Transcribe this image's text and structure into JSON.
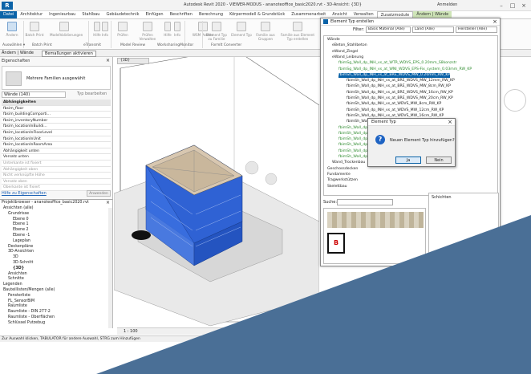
{
  "app": {
    "title": "Autodesk Revit 2020 - VIEWER-MODUS - ananoteoffice_basic2020.rvt - 3D-Ansicht: {3D}",
    "logo": "R",
    "user": "Anmelden"
  },
  "tabs": [
    "Datei",
    "Architektur",
    "Ingenieurbau",
    "Stahlbau",
    "Gebäudetechnik",
    "Einfügen",
    "Beschriften",
    "Berechnung",
    "Körpermodell & Grundstück",
    "Zusammenarbeit",
    "Ansicht",
    "Verwalten",
    "Zusatzmodule",
    "Ändern | Wände"
  ],
  "ribbon": {
    "buttons": [
      "Ändern",
      "Batch Print",
      "ModelValidierungen",
      "Hilfe",
      "Info",
      "Prüfen",
      "Prüfen Verwalten",
      "Hilfe",
      "Info",
      "WSM Palette",
      "Element Typ zu Familie",
      "Element Typ",
      "Familie aus Gruppen",
      "Familie aus Element Typ erstellen"
    ],
    "groups": [
      "Auswählen ▾",
      "Batch Print",
      "eTransmit",
      "Model Review",
      "WorksharingMonitor",
      "FormIt Converter"
    ]
  },
  "options_bar": {
    "context": "Ändern | Wände",
    "button": "Bemaßungen aktivieren"
  },
  "properties": {
    "title": "Eigenschaften",
    "family_selector": "Mehrere Familien ausgewählt",
    "instance_filter": "Wände (140)",
    "edit_type": "Typ bearbeiten",
    "rows": [
      "Abhängigkeiten",
      "fbsim_floor",
      "fbsim_buildingComparti...",
      "fbsim_inventoryNumber",
      "fbsim_locationInBuildi...",
      "fbsim_locationInFloorLevel",
      "fbsim_locationInUnit",
      "fbsim_locationInRoomArea",
      "Abhängigkeit unten",
      "Versatz unten",
      "Unterkante ist fixiert",
      "Abhängigkeit oben",
      "Nicht verknüpfte Höhe",
      "Versatz oben",
      "Oberkante ist fixiert"
    ],
    "help_link": "Hilfe zu Eigenschaften",
    "apply": "Anwenden"
  },
  "project_browser": {
    "title": "Projektbrowser - ananoteoffice_basic2020.rvt",
    "items": [
      "Ansichten (alle)",
      "Grundrisse",
      "Ebene 0",
      "Ebene 1",
      "Ebene 2",
      "Ebene -1",
      "Lageplan",
      "Deckenpläne",
      "3D-Ansichten",
      "3D",
      "3D-Schnitt",
      "{3D}",
      "Ansichten",
      "Schnitte",
      "Legenden",
      "Bauteillisten/Mengen (alle)",
      "Fensterliste",
      "FL_SensorBIM",
      "Raumliste",
      "Raumliste - DIN 277-2",
      "Raumliste - Oberflächen",
      "Schlüssel Putzebug"
    ]
  },
  "viewport": {
    "tab": "{3D}",
    "scale": "1 : 100"
  },
  "status_bar": "Zur Auswahl klicken, TABULATOR für andere Auswahl, STRG zum Hinzufügen",
  "element_type_dialog": {
    "title": "Element Typ erstellen",
    "filter_label": "Filter:",
    "filters": [
      "Basis Material (Alle)",
      "Land (Alle)",
      "Hersteller (Alle)"
    ],
    "tree": [
      "Wände",
      "eBeton_Stahlbeton",
      "eWand_Ziegel",
      "eWand_Leibnung",
      "fbimSg_Wall_dp_INH_vs_at_WTR_WDVS_EPS_0.20mm_S8konzstr",
      "fbimSg_Wall_dp_INH_vs_at_WNI_WDVS_EPS-Fix_system_0.03mm_RW_KP",
      "fbimSh_Wall_dp_INH_vs_at_BRE_WDVS_MW_0.20mm_RW_KP",
      "fbimSh_Wall_dp_INH_vs_at_BRE_WDVS_MW_12mm_RW_KP",
      "fbimSh_Wall_dp_INH_vs_at_BRE_WDVS_MW_8cm_RW_KP",
      "fbimSh_Wall_dp_INH_vs_at_BRE_WDVS_MW_16cm_RW_KP",
      "fbimSh_Wall_dp_INH_vs_at_BRE_WDVS_MW_20cm_RW_KP",
      "fbimSh_Wall_dp_INH_vs_at_WDVS_MW_8cm_RW_KP",
      "fbimSh_Wall_dp_INH_vs_at_WDVS_MW_12cm_RW_KP",
      "fbimSh_Wall_dp_INH_vs_at_WDVS_MW_16cm_RW_KP",
      "fbimSh_Wall_dp_INH_vs_at_WDVS_MW_20cm_RW_KP",
      "fbimSh_Wall_dp",
      "fbimSh_Wall_dp",
      "fbimSh_Wall_dp",
      "fbimSh_Wall_dp",
      "fbimSh_Wall_dp",
      "fbimSh_Wall_dp",
      "Wand_Trockenbau",
      "Geschossdecken",
      "Fundamente",
      "Tragwerkstützen",
      "Skelettbau"
    ],
    "search_label": "Suche:",
    "props_label": "Schichten"
  },
  "confirm_dialog": {
    "title": "Element Typ",
    "message": "Neuen Element Typ hinzufügen?",
    "yes": "Ja",
    "no": "Nein"
  },
  "colors": {
    "accent": "#0b63a8",
    "building": "#2f62d4",
    "overlay": "#4a6f96"
  }
}
